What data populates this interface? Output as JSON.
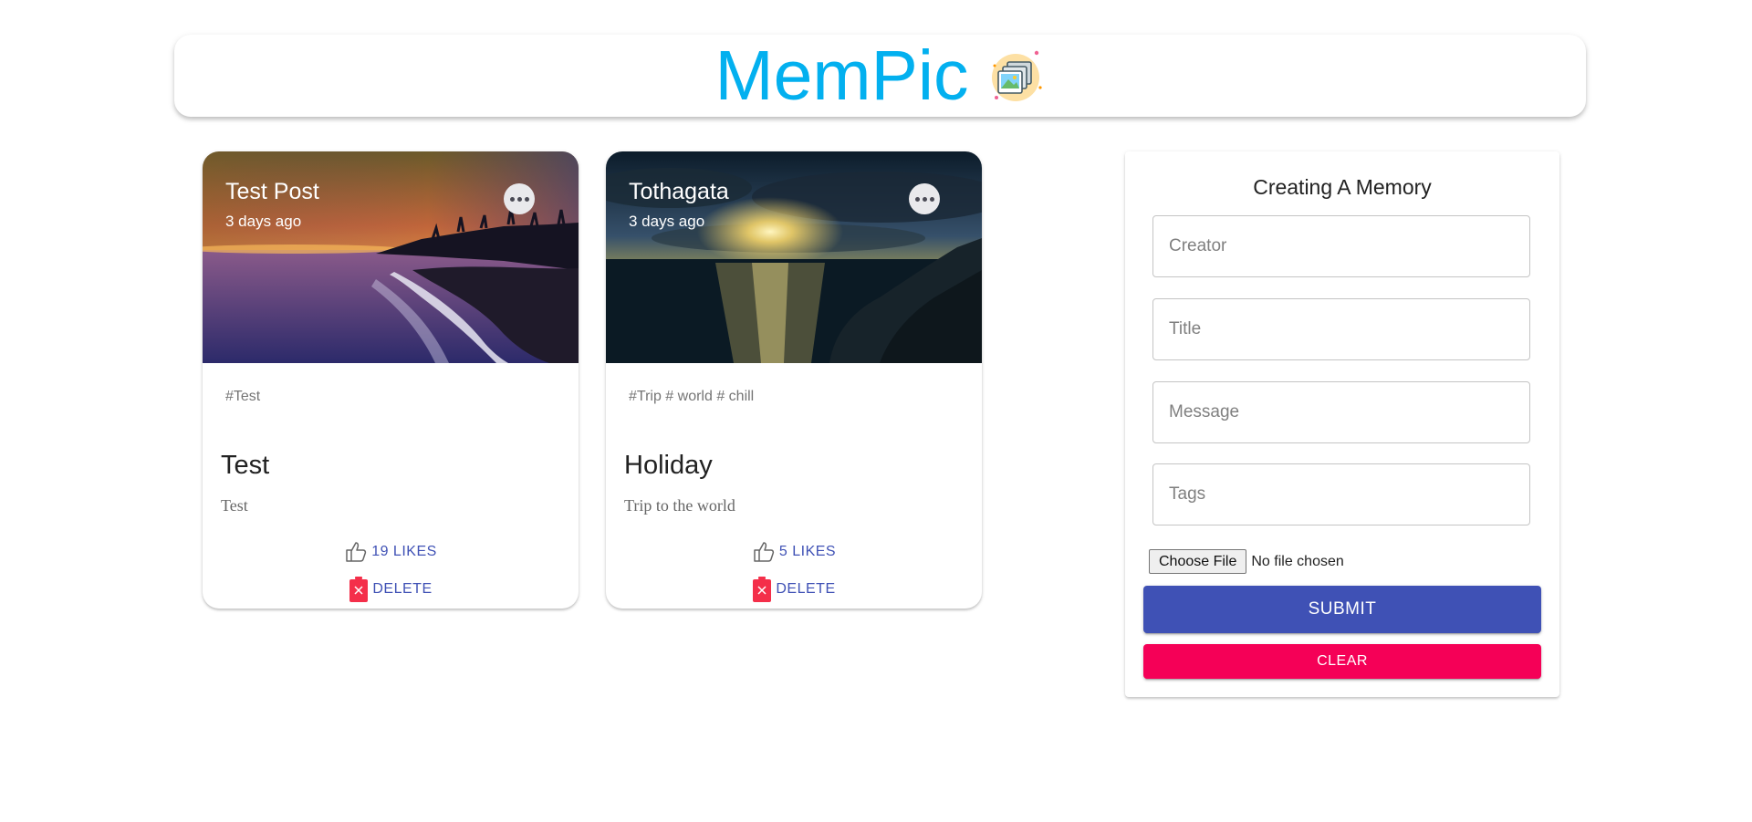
{
  "app": {
    "brand_name": "MemPic",
    "logo_icon": "photo-gallery-icon"
  },
  "posts": [
    {
      "creator": "Test Post",
      "time_ago": "3 days ago",
      "image": "sunset-beach-photo",
      "tags": "#Test",
      "title": "Test",
      "message": "Test",
      "likes_label": "19 LIKES",
      "delete_label": "DELETE"
    },
    {
      "creator": "Tothagata",
      "time_ago": "3 days ago",
      "image": "ocean-sunset-cliff-photo",
      "tags": "#Trip # world # chill",
      "title": "Holiday",
      "message": "Trip to the world",
      "likes_label": "5 LIKES",
      "delete_label": "DELETE"
    }
  ],
  "form": {
    "heading": "Creating A Memory",
    "creator_placeholder": "Creator",
    "title_placeholder": "Title",
    "message_placeholder": "Message",
    "tags_placeholder": "Tags",
    "file_button_label": "Choose File",
    "file_status": "No file chosen",
    "submit_label": "SUBMIT",
    "clear_label": "CLEAR"
  },
  "colors": {
    "brand": "#03b0ef",
    "primary": "#3f51b5",
    "secondary": "#f50057"
  }
}
